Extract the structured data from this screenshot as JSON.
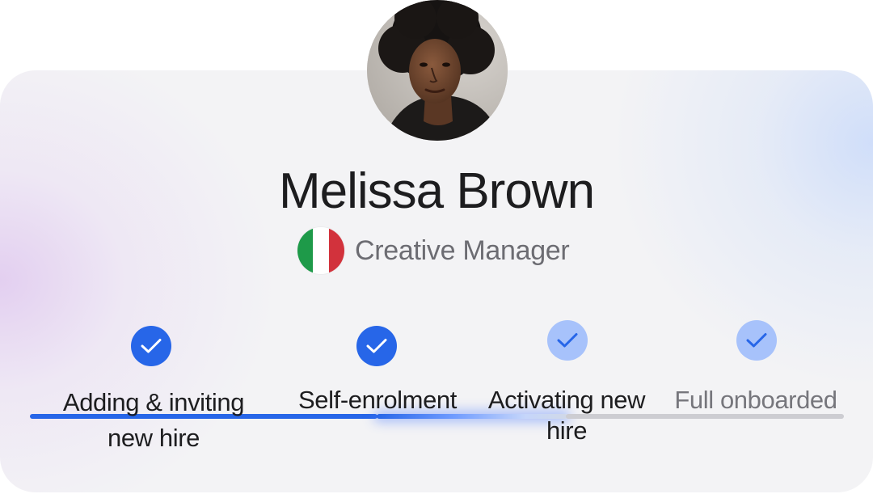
{
  "profile": {
    "name": "Melissa Brown",
    "role": "Creative Manager",
    "country_flag": "italy-flag",
    "flag_colors": [
      "#1e9a49",
      "#ffffff",
      "#d2323c"
    ]
  },
  "onboarding": {
    "steps": [
      {
        "label": "Adding & inviting new hire",
        "status": "complete"
      },
      {
        "label": "Self-enrolment",
        "status": "complete"
      },
      {
        "label": "Activating new hire",
        "status": "pending"
      },
      {
        "label": "Full onboarded",
        "status": "pending"
      }
    ]
  },
  "icons": {
    "step_status": "check-icon"
  },
  "colors": {
    "accent": "#2766e8",
    "accent_light": "#a7c2fb",
    "track_inactive": "#cdcdd2",
    "text_primary": "#1d1d1f",
    "text_secondary": "#6c6c72"
  }
}
